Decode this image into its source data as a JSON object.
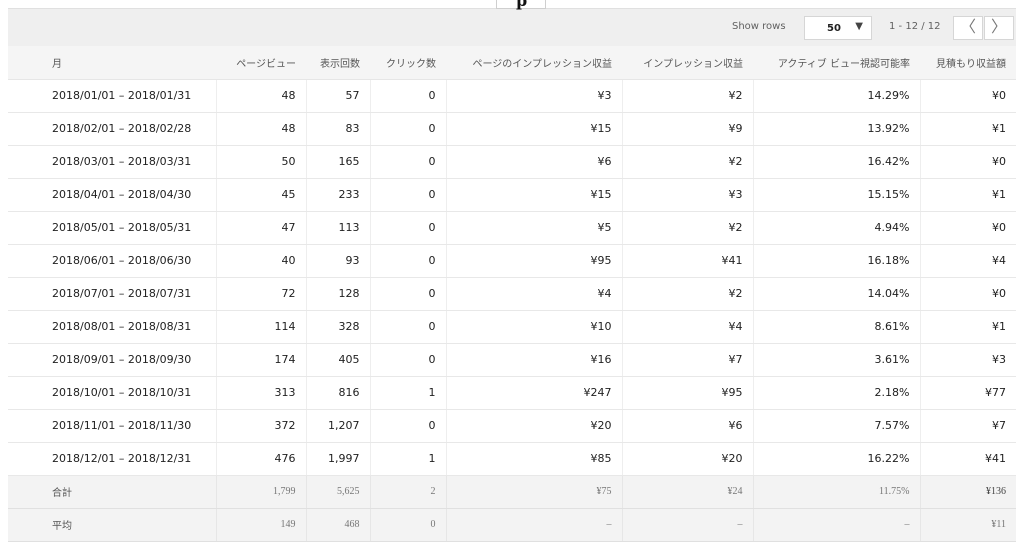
{
  "tab_glyph": "p",
  "toolbar": {
    "show_rows_label": "Show rows",
    "rows_value": "50",
    "range_text": "1 - 12 / 12",
    "prev_glyph": "〈",
    "next_glyph": "〉"
  },
  "table": {
    "headers": [
      "月",
      "ページビュー",
      "表示回数",
      "クリック数",
      "ページのインプレッション収益",
      "インプレッション収益",
      "アクティブ ビュー視認可能率",
      "見積もり収益額"
    ],
    "rows": [
      [
        "2018/01/01 – 2018/01/31",
        "48",
        "57",
        "0",
        "¥3",
        "¥2",
        "14.29%",
        "¥0"
      ],
      [
        "2018/02/01 – 2018/02/28",
        "48",
        "83",
        "0",
        "¥15",
        "¥9",
        "13.92%",
        "¥1"
      ],
      [
        "2018/03/01 – 2018/03/31",
        "50",
        "165",
        "0",
        "¥6",
        "¥2",
        "16.42%",
        "¥0"
      ],
      [
        "2018/04/01 – 2018/04/30",
        "45",
        "233",
        "0",
        "¥15",
        "¥3",
        "15.15%",
        "¥1"
      ],
      [
        "2018/05/01 – 2018/05/31",
        "47",
        "113",
        "0",
        "¥5",
        "¥2",
        "4.94%",
        "¥0"
      ],
      [
        "2018/06/01 – 2018/06/30",
        "40",
        "93",
        "0",
        "¥95",
        "¥41",
        "16.18%",
        "¥4"
      ],
      [
        "2018/07/01 – 2018/07/31",
        "72",
        "128",
        "0",
        "¥4",
        "¥2",
        "14.04%",
        "¥0"
      ],
      [
        "2018/08/01 – 2018/08/31",
        "114",
        "328",
        "0",
        "¥10",
        "¥4",
        "8.61%",
        "¥1"
      ],
      [
        "2018/09/01 – 2018/09/30",
        "174",
        "405",
        "0",
        "¥16",
        "¥7",
        "3.61%",
        "¥3"
      ],
      [
        "2018/10/01 – 2018/10/31",
        "313",
        "816",
        "1",
        "¥247",
        "¥95",
        "2.18%",
        "¥77"
      ],
      [
        "2018/11/01 – 2018/11/30",
        "372",
        "1,207",
        "0",
        "¥20",
        "¥6",
        "7.57%",
        "¥7"
      ],
      [
        "2018/12/01 – 2018/12/31",
        "476",
        "1,997",
        "1",
        "¥85",
        "¥20",
        "16.22%",
        "¥41"
      ]
    ],
    "totals": [
      "合計",
      "1,799",
      "5,625",
      "2",
      "¥75",
      "¥24",
      "11.75%",
      "¥136"
    ],
    "averages": [
      "平均",
      "149",
      "468",
      "0",
      "–",
      "–",
      "–",
      "¥11"
    ]
  }
}
